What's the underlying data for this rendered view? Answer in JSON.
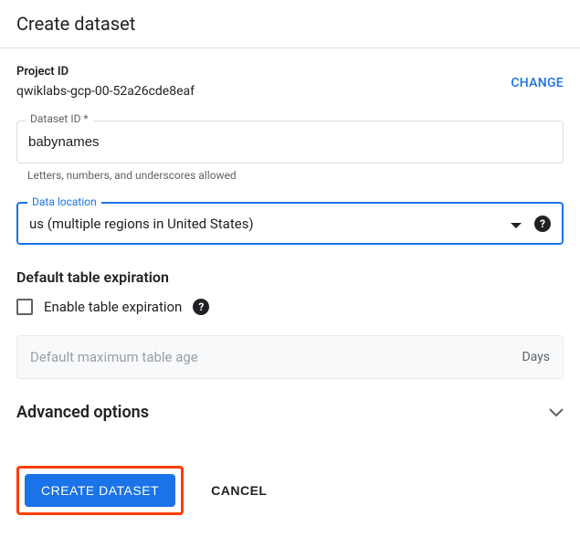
{
  "header": {
    "title": "Create dataset"
  },
  "project": {
    "label": "Project ID",
    "value": "qwiklabs-gcp-00-52a26cde8eaf",
    "change": "CHANGE"
  },
  "dataset": {
    "label": "Dataset ID *",
    "value": "babynames",
    "helper": "Letters, numbers, and underscores allowed"
  },
  "location": {
    "label": "Data location",
    "value": "us (multiple regions in United States)"
  },
  "expiration": {
    "heading": "Default table expiration",
    "checkbox_label": "Enable table expiration",
    "max_age_placeholder": "Default maximum table age",
    "unit": "Days"
  },
  "advanced": {
    "title": "Advanced options"
  },
  "actions": {
    "create": "CREATE DATASET",
    "cancel": "CANCEL"
  }
}
